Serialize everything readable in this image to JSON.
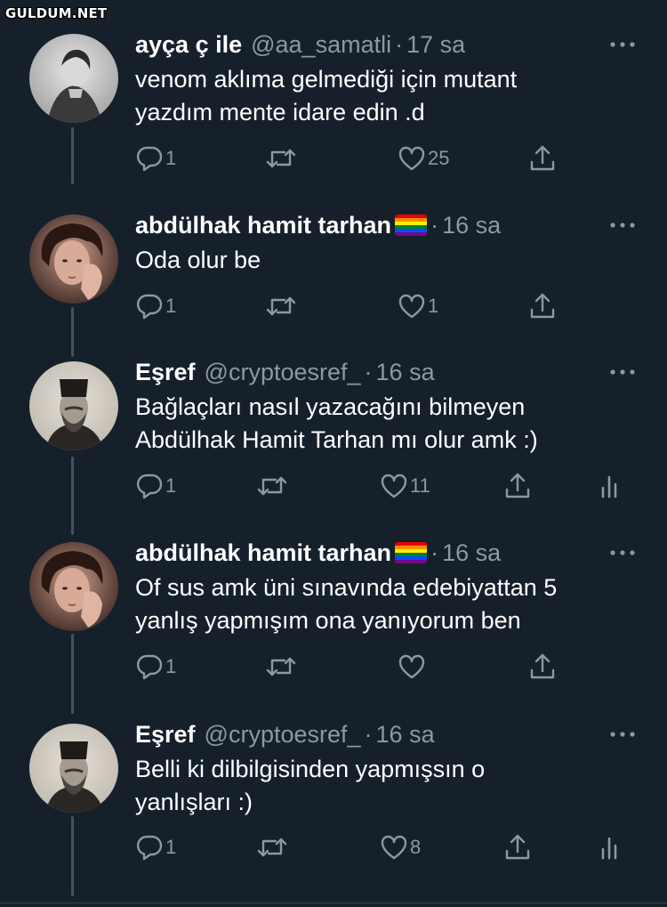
{
  "watermark": "GULDUM.NET",
  "colors": {
    "background": "#15202b",
    "secondary_text": "#8b98a5",
    "thread_line": "#3d5466"
  },
  "tweets": [
    {
      "name": "ayça ç ile",
      "handle": "@aa_samatli",
      "separator": "·",
      "time": "17 sa",
      "text_lines": [
        "venom aklıma gelmediği için mutant",
        "yazdım mente idare edin .d"
      ],
      "replies": "1",
      "retweets": "",
      "likes": "25",
      "avatar": "avatar-woman-bw",
      "has_flag": false,
      "has_analytics": false
    },
    {
      "name": "abdülhak hamit tarhan",
      "handle": "",
      "separator": "·",
      "time": "16 sa",
      "text_lines": [
        "Oda olur be"
      ],
      "replies": "1",
      "retweets": "",
      "likes": "1",
      "avatar": "avatar-curly-hair",
      "has_flag": true,
      "has_analytics": false
    },
    {
      "name": "Eşref",
      "handle": "@cryptoesref_",
      "separator": "·",
      "time": "16 sa",
      "text_lines": [
        "Bağlaçları nasıl yazacağını bilmeyen",
        "Abdülhak Hamit Tarhan mı olur amk :)"
      ],
      "replies": "1",
      "retweets": "",
      "likes": "11",
      "avatar": "avatar-fez-portrait",
      "has_flag": false,
      "has_analytics": true
    },
    {
      "name": "abdülhak hamit tarhan",
      "handle": "",
      "separator": "·",
      "time": "16 sa",
      "text_lines": [
        "Of sus amk üni sınavında edebiyattan 5",
        "yanlış yapmışım ona yanıyorum ben"
      ],
      "replies": "1",
      "retweets": "",
      "likes": "",
      "avatar": "avatar-curly-hair",
      "has_flag": true,
      "has_analytics": false
    },
    {
      "name": "Eşref",
      "handle": "@cryptoesref_",
      "separator": "·",
      "time": "16 sa",
      "text_lines": [
        "Belli ki dilbilgisinden yapmışsın o",
        "yanlışları :)"
      ],
      "replies": "1",
      "retweets": "",
      "likes": "8",
      "avatar": "avatar-fez-portrait",
      "has_flag": false,
      "has_analytics": true
    }
  ]
}
